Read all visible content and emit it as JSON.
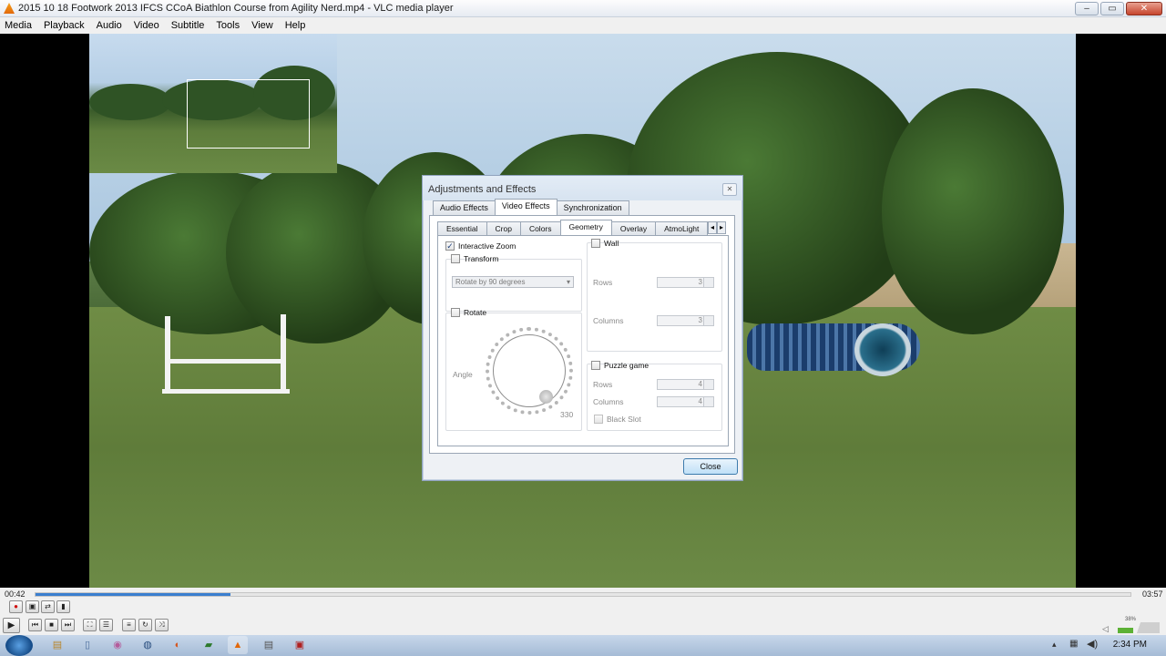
{
  "window": {
    "title": "2015 10 18 Footwork  2013 IFCS CCoA Biathlon Course from Agility Nerd.mp4 - VLC media player"
  },
  "menu": [
    "Media",
    "Playback",
    "Audio",
    "Video",
    "Subtitle",
    "Tools",
    "View",
    "Help"
  ],
  "dialog": {
    "title": "Adjustments and Effects",
    "tabs": [
      "Audio Effects",
      "Video Effects",
      "Synchronization"
    ],
    "subtabs": [
      "Essential",
      "Crop",
      "Colors",
      "Geometry",
      "Overlay",
      "AtmoLight"
    ],
    "interactive_zoom": {
      "label": "Interactive Zoom",
      "checked": true
    },
    "transform": {
      "label": "Transform",
      "checked": false,
      "option": "Rotate by 90 degrees"
    },
    "rotate": {
      "label": "Rotate",
      "checked": false,
      "angle_label": "Angle",
      "angle_value": "330"
    },
    "wall": {
      "label": "Wall",
      "rows_label": "Rows",
      "rows": "3",
      "columns_label": "Columns",
      "columns": "3"
    },
    "puzzle": {
      "label": "Puzzle game",
      "rows_label": "Rows",
      "rows": "4",
      "columns_label": "Columns",
      "columns": "4",
      "black_slot": "Black Slot"
    },
    "close": "Close"
  },
  "player": {
    "elapsed": "00:42",
    "total": "03:57",
    "progress": 0.178,
    "volume": "38%"
  },
  "taskbar": {
    "time": "2:34 PM"
  }
}
